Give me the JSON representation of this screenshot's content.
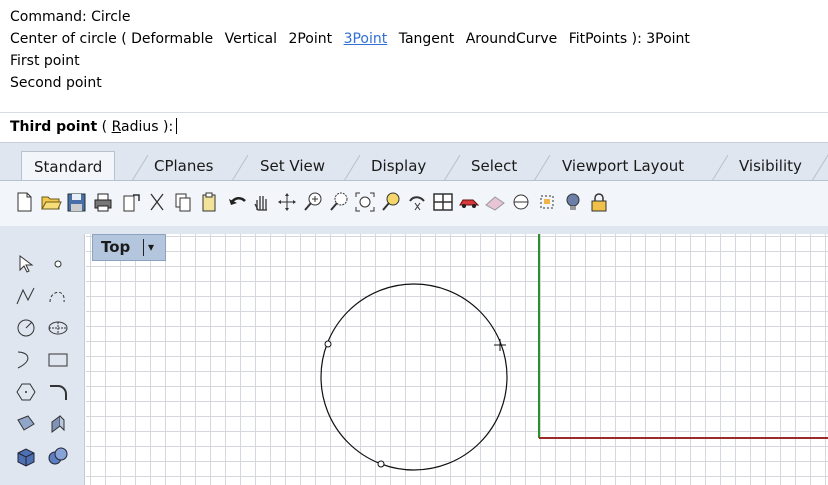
{
  "command_history": {
    "line1": "Command: Circle",
    "line2_prefix": "Center of circle (",
    "line2_options": [
      "Deformable",
      "Vertical",
      "2Point",
      "3Point",
      "Tangent",
      "AroundCurve",
      "FitPoints"
    ],
    "line2_suffix": "): 3Point",
    "line3": "First point",
    "line4": "Second point"
  },
  "prompt": {
    "label": "Third point",
    "options_open": " ( ",
    "option_radius_first": "R",
    "option_radius_rest": "adius",
    "options_close": " ):"
  },
  "tabs": [
    "Standard",
    "CPlanes",
    "Set View",
    "Display",
    "Select",
    "Viewport Layout",
    "Visibility"
  ],
  "active_tab": "Standard",
  "toolbar_icons": [
    "new-document-icon",
    "open-folder-icon",
    "save-icon",
    "print-icon",
    "import-icon",
    "cut-icon",
    "copy-icon",
    "paste-icon",
    "undo-icon",
    "pan-hand-icon",
    "rotate-view-icon",
    "zoom-window-icon",
    "zoom-dynamic-icon",
    "zoom-extents-icon",
    "zoom-selected-icon",
    "undo-view-icon",
    "four-viewports-icon",
    "car-render-icon",
    "shaded-icon",
    "object-snap-icon",
    "layer-icon",
    "light-bulb-icon",
    "lock-icon"
  ],
  "palette_tools": [
    "select-arrow-icon",
    "point-icon",
    "polyline-icon",
    "curve-icon",
    "circle-icon",
    "ellipse-icon",
    "arc-icon",
    "rectangle-icon",
    "polygon-icon",
    "fillet-icon",
    "surface-icon",
    "extrude-icon",
    "box-icon",
    "boolean-icon"
  ],
  "viewport": {
    "name": "Top",
    "dropdown": "▾"
  },
  "colors": {
    "link": "#2f6fd6",
    "y_axis": "#2c8f2c",
    "x_axis": "#9b2a2a",
    "grid": "#d4d7dc",
    "viewport_label_bg": "#b4c6dd"
  }
}
